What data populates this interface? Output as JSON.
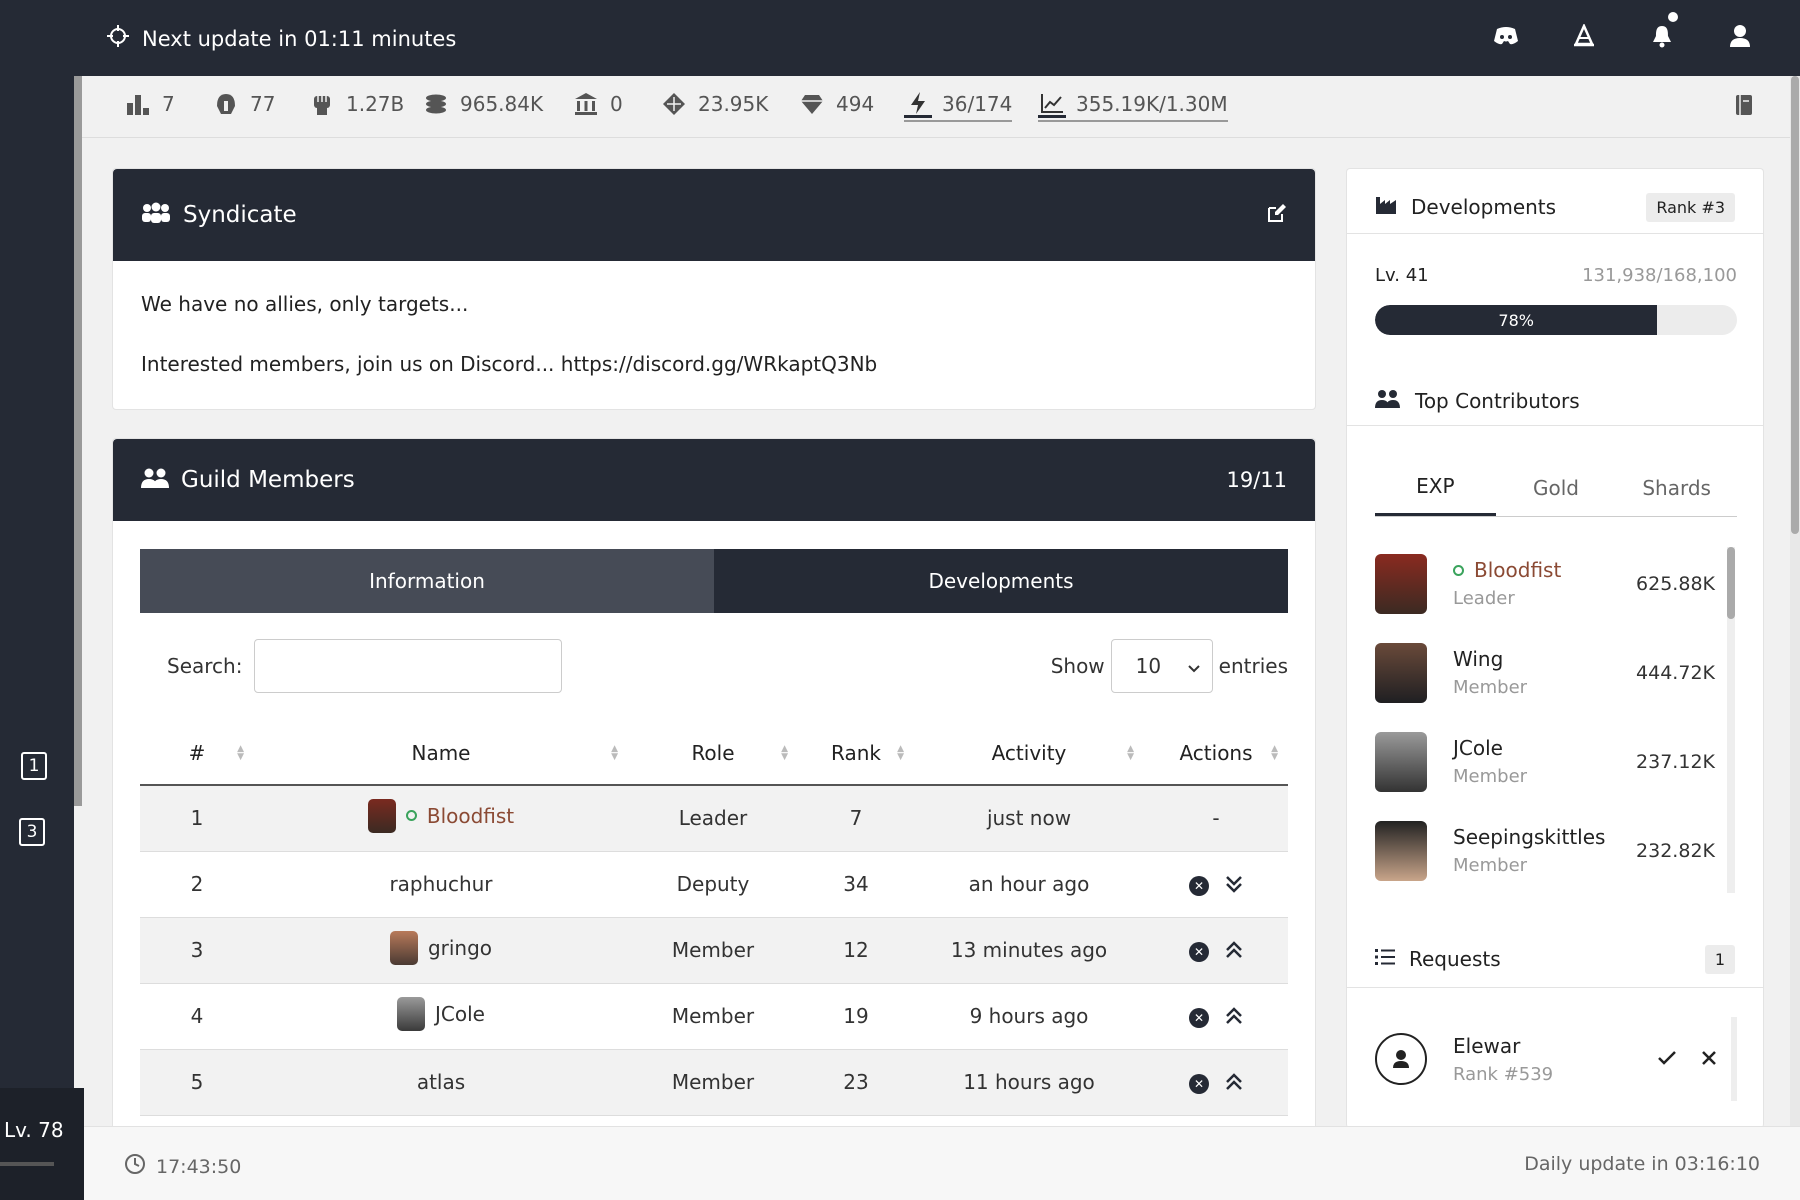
{
  "topbar": {
    "update_text": "Next update in 01:11 minutes",
    "icons": [
      "discord-icon",
      "hat-icon",
      "bell-icon",
      "user-icon"
    ]
  },
  "sidebar": {
    "badges": [
      "1",
      "3"
    ],
    "level": "Lv. 78"
  },
  "stats": [
    {
      "icon": "rank-icon",
      "value": "7"
    },
    {
      "icon": "helmet-icon",
      "value": "77"
    },
    {
      "icon": "fist-icon",
      "value": "1.27B"
    },
    {
      "icon": "coins-icon",
      "value": "965.84K"
    },
    {
      "icon": "bank-icon",
      "value": "0"
    },
    {
      "icon": "shard-icon",
      "value": "23.95K"
    },
    {
      "icon": "gem-icon",
      "value": "494"
    },
    {
      "icon": "bolt-icon",
      "value": "36/174"
    },
    {
      "icon": "chart-icon",
      "value": "355.19K/1.30M"
    }
  ],
  "syndicate": {
    "title": "Syndicate",
    "line1": "We have no allies, only targets...",
    "line2": "Interested members, join us on Discord... https://discord.gg/WRkaptQ3Nb"
  },
  "guild": {
    "title": "Guild Members",
    "count": "19/11",
    "tabs": [
      "Information",
      "Developments"
    ],
    "search_label": "Search:",
    "show_label": "Show",
    "show_value": "10",
    "entries_label": "entries",
    "columns": [
      "#",
      "Name",
      "Role",
      "Rank",
      "Activity",
      "Actions"
    ],
    "rows": [
      {
        "num": "1",
        "name": "Bloodfist",
        "role": "Leader",
        "rank": "7",
        "activity": "just now",
        "actions": "-"
      },
      {
        "num": "2",
        "name": "raphuchur",
        "role": "Deputy",
        "rank": "34",
        "activity": "an hour ago",
        "actions": ""
      },
      {
        "num": "3",
        "name": "gringo",
        "role": "Member",
        "rank": "12",
        "activity": "13 minutes ago",
        "actions": ""
      },
      {
        "num": "4",
        "name": "JCole",
        "role": "Member",
        "rank": "19",
        "activity": "9 hours ago",
        "actions": ""
      },
      {
        "num": "5",
        "name": "atlas",
        "role": "Member",
        "rank": "23",
        "activity": "11 hours ago",
        "actions": ""
      }
    ]
  },
  "developments": {
    "title": "Developments",
    "rank": "Rank #3",
    "level": "Lv. 41",
    "xp": "131,938/168,100",
    "progress": 0.78,
    "progress_label": "78%"
  },
  "contributors": {
    "title": "Top Contributors",
    "tabs": [
      "EXP",
      "Gold",
      "Shards"
    ],
    "list": [
      {
        "name": "Bloodfist",
        "role": "Leader",
        "value": "625.88K"
      },
      {
        "name": "Wing",
        "role": "Member",
        "value": "444.72K"
      },
      {
        "name": "JCole",
        "role": "Member",
        "value": "237.12K"
      },
      {
        "name": "Seepingskittles",
        "role": "Member",
        "value": "232.82K"
      }
    ]
  },
  "requests": {
    "title": "Requests",
    "count": "1",
    "items": [
      {
        "name": "Elewar",
        "rank": "Rank #539"
      }
    ]
  },
  "footer": {
    "time": "17:43:50",
    "daily": "Daily update in 03:16:10"
  }
}
